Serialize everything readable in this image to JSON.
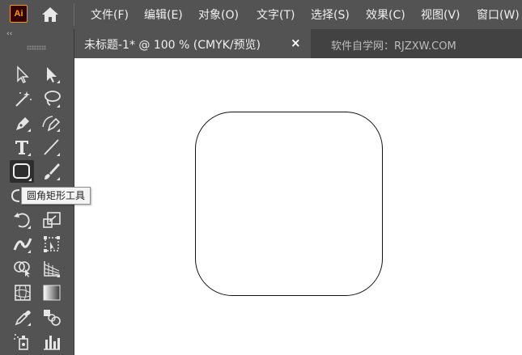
{
  "app": {
    "logo_text": "Ai",
    "logo_color": "#ff9a00"
  },
  "menu": {
    "items": [
      "文件(F)",
      "编辑(E)",
      "对象(O)",
      "文字(T)",
      "选择(S)",
      "效果(C)",
      "视图(V)",
      "窗口(W)"
    ]
  },
  "tabs": {
    "active_title": "未标题-1* @ 100 % (CMYK/预览)",
    "close_symbol": "×",
    "watermark": "软件自学网：RJZXW.COM"
  },
  "toolbar": {
    "collapse_symbol": "‹‹",
    "selected_tool": "rounded-rectangle-tool",
    "tooltip": "圆角矩形工具",
    "tools": [
      "selection-tool",
      "direct-selection-tool",
      "magic-wand-tool",
      "lasso-tool",
      "pen-tool",
      "curvature-tool",
      "type-tool",
      "line-segment-tool",
      "rounded-rectangle-tool",
      "paintbrush-tool",
      "shaper-tool",
      "rotate-tool",
      "scale-tool",
      "width-tool",
      "free-transform-tool",
      "shape-builder-tool",
      "perspective-grid-tool",
      "mesh-tool",
      "gradient-tool",
      "eyedropper-tool",
      "blend-tool",
      "symbol-sprayer-tool",
      "column-graph-tool"
    ]
  },
  "colors": {
    "menubar": "#535353",
    "tabbar": "#424242",
    "canvas": "#ffffff"
  }
}
